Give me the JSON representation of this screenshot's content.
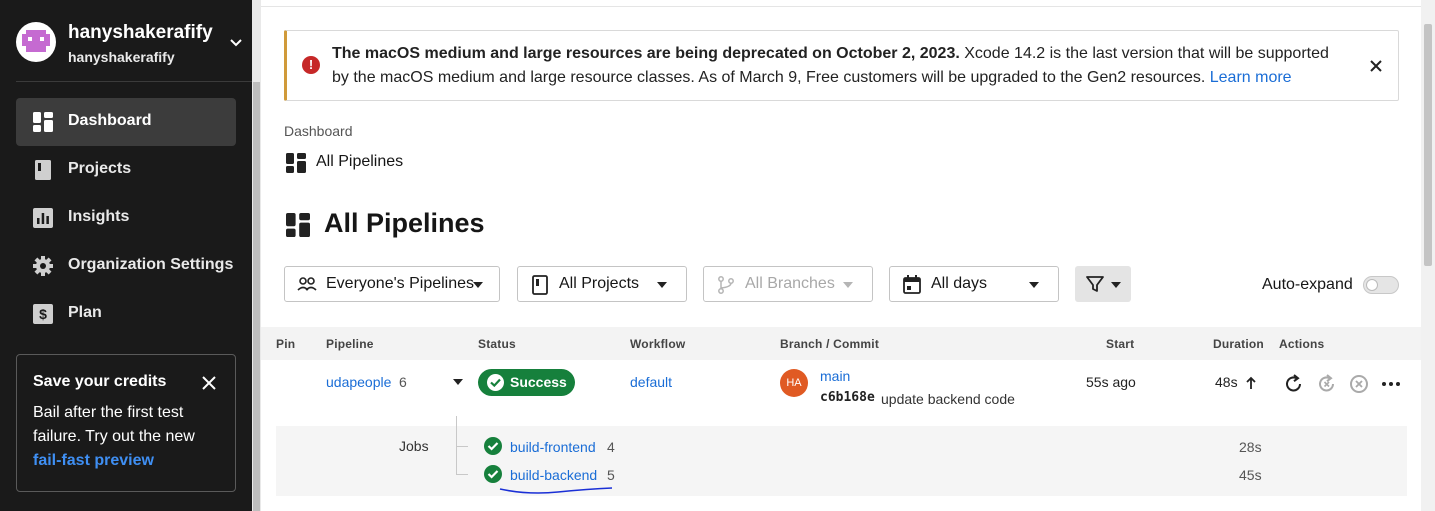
{
  "sidebar": {
    "username": "hanyshakerafify",
    "org": "hanyshakerafify",
    "nav": [
      {
        "label": "Dashboard",
        "icon": "dashboard-icon",
        "active": true
      },
      {
        "label": "Projects",
        "icon": "projects-icon"
      },
      {
        "label": "Insights",
        "icon": "insights-icon"
      },
      {
        "label": "Organization Settings",
        "icon": "gear-icon"
      },
      {
        "label": "Plan",
        "icon": "dollar-icon"
      }
    ],
    "promo": {
      "title": "Save your credits",
      "body": "Bail after the first test failure. Try out the new",
      "link": "fail-fast preview"
    }
  },
  "banner": {
    "bold": "The macOS medium and large resources are being deprecated on October 2, 2023.",
    "text": " Xcode 14.2 is the last version that will be supported by the macOS medium and large resource classes. As of March 9, Free customers will be upgraded to the Gen2 resources.",
    "link": "Learn more"
  },
  "breadcrumb": {
    "root": "Dashboard",
    "current": "All Pipelines"
  },
  "page_title": "All Pipelines",
  "filters": {
    "pipelines": "Everyone's Pipelines",
    "projects": "All Projects",
    "branches": "All Branches",
    "days": "All days",
    "auto_expand": "Auto-expand"
  },
  "table": {
    "headers": {
      "pin": "Pin",
      "pipeline": "Pipeline",
      "status": "Status",
      "workflow": "Workflow",
      "branch": "Branch / Commit",
      "start": "Start",
      "duration": "Duration",
      "actions": "Actions"
    },
    "row": {
      "pipeline": "udapeople",
      "number": "6",
      "status": "Success",
      "workflow": "default",
      "avatar": "HA",
      "branch": "main",
      "commit_hash": "c6b168e",
      "commit_msg": "update backend code",
      "start": "55s ago",
      "duration": "48s"
    },
    "jobs_label": "Jobs",
    "jobs": [
      {
        "name": "build-frontend",
        "number": "4",
        "duration": "28s"
      },
      {
        "name": "build-backend",
        "number": "5",
        "duration": "45s"
      }
    ]
  },
  "colors": {
    "sidebar_bg": "#1a1a1a",
    "success": "#16803c",
    "link": "#1a6dd6",
    "banner_accent": "#d09a3a",
    "error": "#c62828"
  }
}
